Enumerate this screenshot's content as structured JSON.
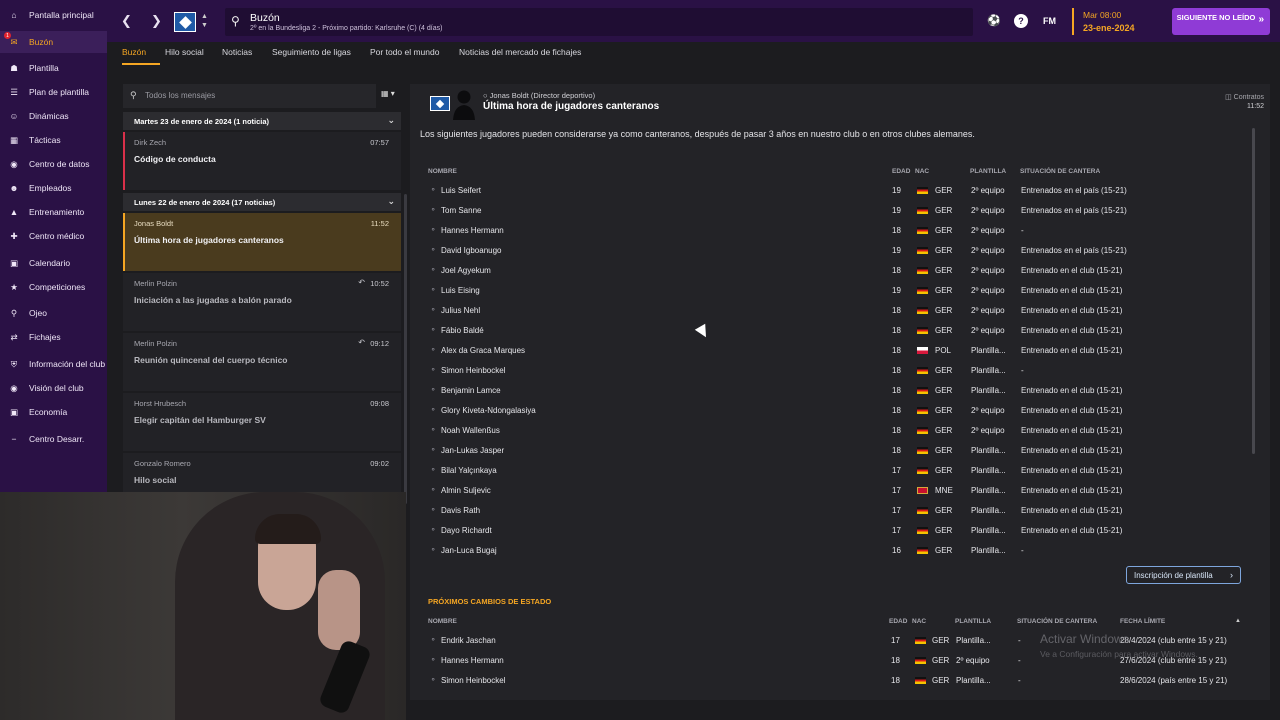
{
  "sidebar": {
    "items": [
      {
        "label": "Pantalla principal",
        "icon": "home-icon"
      },
      {
        "label": "Buzón",
        "icon": "inbox-icon",
        "badge": "1"
      },
      {
        "label": "Plantilla",
        "icon": "shirt-icon"
      },
      {
        "label": "Plan de plantilla",
        "icon": "plan-icon"
      },
      {
        "label": "Dinámicas",
        "icon": "dynamics-icon"
      },
      {
        "label": "Tácticas",
        "icon": "tactics-icon"
      },
      {
        "label": "Centro de datos",
        "icon": "data-icon"
      },
      {
        "label": "Empleados",
        "icon": "staff-icon"
      },
      {
        "label": "Entrenamiento",
        "icon": "training-icon"
      },
      {
        "label": "Centro médico",
        "icon": "medical-icon"
      },
      {
        "label": "Calendario",
        "icon": "calendar-icon"
      },
      {
        "label": "Competiciones",
        "icon": "trophy-icon"
      },
      {
        "label": "Ojeo",
        "icon": "scout-icon"
      },
      {
        "label": "Fichajes",
        "icon": "transfer-icon"
      },
      {
        "label": "Información del club",
        "icon": "shield-icon"
      },
      {
        "label": "Visión del club",
        "icon": "vision-icon"
      },
      {
        "label": "Economía",
        "icon": "money-icon"
      },
      {
        "label": "Centro Desarr.",
        "icon": "development-icon"
      }
    ]
  },
  "topbar": {
    "title": "Buzón",
    "subtitle": "2º en la Bundesliga 2 - Próximo partido: Karlsruhe (C) (4 días)",
    "fm_logo": "FM",
    "help": "?",
    "time": "Mar 08:00",
    "date": "23-ene-2024",
    "next_button": "SIGUIENTE NO LEÍDO"
  },
  "tabs": [
    "Buzón",
    "Hilo social",
    "Noticias",
    "Seguimiento de ligas",
    "Por todo el mundo",
    "Noticias del mercado de fichajes"
  ],
  "inbox": {
    "filter_placeholder": "Todos los mensajes",
    "days": [
      {
        "label": "Martes 23 de enero de 2024 (1 noticia)"
      },
      {
        "label": "Lunes 22 de enero de 2024 (17 noticias)"
      }
    ],
    "messages": [
      {
        "from": "Dirk Zech",
        "time": "07:57",
        "subject": "Código de conducta"
      },
      {
        "from": "Jonas Boldt",
        "time": "11:52",
        "subject": "Última hora de jugadores canteranos"
      },
      {
        "from": "Merlin Polzin",
        "time": "10:52",
        "subject": "Iniciación a las jugadas a balón parado"
      },
      {
        "from": "Merlin Polzin",
        "time": "09:12",
        "subject": "Reunión quincenal del cuerpo técnico"
      },
      {
        "from": "Horst Hrubesch",
        "time": "09:08",
        "subject": "Elegir capitán del Hamburger SV"
      },
      {
        "from": "Gonzalo Romero",
        "time": "09:02",
        "subject": "Hilo social"
      }
    ]
  },
  "message": {
    "from": "Jonas Boldt  (Director deportivo)",
    "subject": "Última hora de jugadores canteranos",
    "tag": "Contratos",
    "time": "11:52",
    "body": "Los siguientes jugadores pueden considerarse ya como canteranos, después de pasar 3 años en nuestro club o en otros clubes alemanes.",
    "columns": {
      "name": "NOMBRE",
      "age": "EDAD",
      "nat": "NAC",
      "squad": "PLANTILLA",
      "status": "SITUACIÓN DE CANTERA"
    },
    "players": [
      {
        "name": "Luis Seifert",
        "age": "19",
        "nat": "GER",
        "flag": "ger",
        "squad": "2º equipo",
        "status": "Entrenados en el país (15-21)"
      },
      {
        "name": "Tom Sanne",
        "age": "19",
        "nat": "GER",
        "flag": "ger",
        "squad": "2º equipo",
        "status": "Entrenados en el país (15-21)"
      },
      {
        "name": "Hannes Hermann",
        "age": "18",
        "nat": "GER",
        "flag": "ger",
        "squad": "2º equipo",
        "status": "-"
      },
      {
        "name": "David Igboanugo",
        "age": "19",
        "nat": "GER",
        "flag": "ger",
        "squad": "2º equipo",
        "status": "Entrenados en el país (15-21)"
      },
      {
        "name": "Joel Agyekum",
        "age": "18",
        "nat": "GER",
        "flag": "ger",
        "squad": "2º equipo",
        "status": "Entrenado en el club (15-21)"
      },
      {
        "name": "Luis Eising",
        "age": "19",
        "nat": "GER",
        "flag": "ger",
        "squad": "2º equipo",
        "status": "Entrenado en el club (15-21)"
      },
      {
        "name": "Julius Nehl",
        "age": "18",
        "nat": "GER",
        "flag": "ger",
        "squad": "2º equipo",
        "status": "Entrenado en el club (15-21)"
      },
      {
        "name": "Fábio Baldé",
        "age": "18",
        "nat": "GER",
        "flag": "ger",
        "squad": "2º equipo",
        "status": "Entrenado en el club (15-21)"
      },
      {
        "name": "Alex da Graca Marques",
        "age": "18",
        "nat": "POL",
        "flag": "pol",
        "squad": "Plantilla...",
        "status": "Entrenado en el club (15-21)"
      },
      {
        "name": "Simon Heinbockel",
        "age": "18",
        "nat": "GER",
        "flag": "ger",
        "squad": "Plantilla...",
        "status": "-"
      },
      {
        "name": "Benjamin Lamce",
        "age": "18",
        "nat": "GER",
        "flag": "ger",
        "squad": "Plantilla...",
        "status": "Entrenado en el club (15-21)"
      },
      {
        "name": "Glory Kiveta-Ndongalasiya",
        "age": "18",
        "nat": "GER",
        "flag": "ger",
        "squad": "2º equipo",
        "status": "Entrenado en el club (15-21)"
      },
      {
        "name": "Noah Wallenßus",
        "age": "18",
        "nat": "GER",
        "flag": "ger",
        "squad": "2º equipo",
        "status": "Entrenado en el club (15-21)"
      },
      {
        "name": "Jan-Lukas Jasper",
        "age": "18",
        "nat": "GER",
        "flag": "ger",
        "squad": "Plantilla...",
        "status": "Entrenado en el club (15-21)"
      },
      {
        "name": "Bilal Yalçınkaya",
        "age": "17",
        "nat": "GER",
        "flag": "ger",
        "squad": "Plantilla...",
        "status": "Entrenado en el club (15-21)"
      },
      {
        "name": "Almin Suljevic",
        "age": "17",
        "nat": "MNE",
        "flag": "mne",
        "squad": "Plantilla...",
        "status": "Entrenado en el club (15-21)"
      },
      {
        "name": "Davis Rath",
        "age": "17",
        "nat": "GER",
        "flag": "ger",
        "squad": "Plantilla...",
        "status": "Entrenado en el club (15-21)"
      },
      {
        "name": "Dayo Richardt",
        "age": "17",
        "nat": "GER",
        "flag": "ger",
        "squad": "Plantilla...",
        "status": "Entrenado en el club (15-21)"
      },
      {
        "name": "Jan-Luca Bugaj",
        "age": "16",
        "nat": "GER",
        "flag": "ger",
        "squad": "Plantilla...",
        "status": "-"
      }
    ],
    "squad_button": "Inscripción de plantilla",
    "upcoming_title": "PRÓXIMOS CAMBIOS DE ESTADO",
    "upcoming_columns": {
      "name": "NOMBRE",
      "age": "EDAD",
      "nat": "NAC",
      "squad": "PLANTILLA",
      "status": "SITUACIÓN DE CANTERA",
      "deadline": "FECHA LÍMITE"
    },
    "upcoming": [
      {
        "name": "Endrik Jaschan",
        "age": "17",
        "nat": "GER",
        "squad": "Plantilla...",
        "status": "-",
        "deadline": "28/4/2024 (club entre 15 y 21)"
      },
      {
        "name": "Hannes Hermann",
        "age": "18",
        "nat": "GER",
        "squad": "2º equipo",
        "status": "-",
        "deadline": "27/6/2024 (club entre 15 y 21)"
      },
      {
        "name": "Simon Heinbockel",
        "age": "18",
        "nat": "GER",
        "squad": "Plantilla...",
        "status": "-",
        "deadline": "28/6/2024 (país entre 15 y 21)"
      }
    ]
  },
  "watermark": {
    "line1": "Activar Windows",
    "line2": "Ve a Configuración para activar Windows."
  }
}
